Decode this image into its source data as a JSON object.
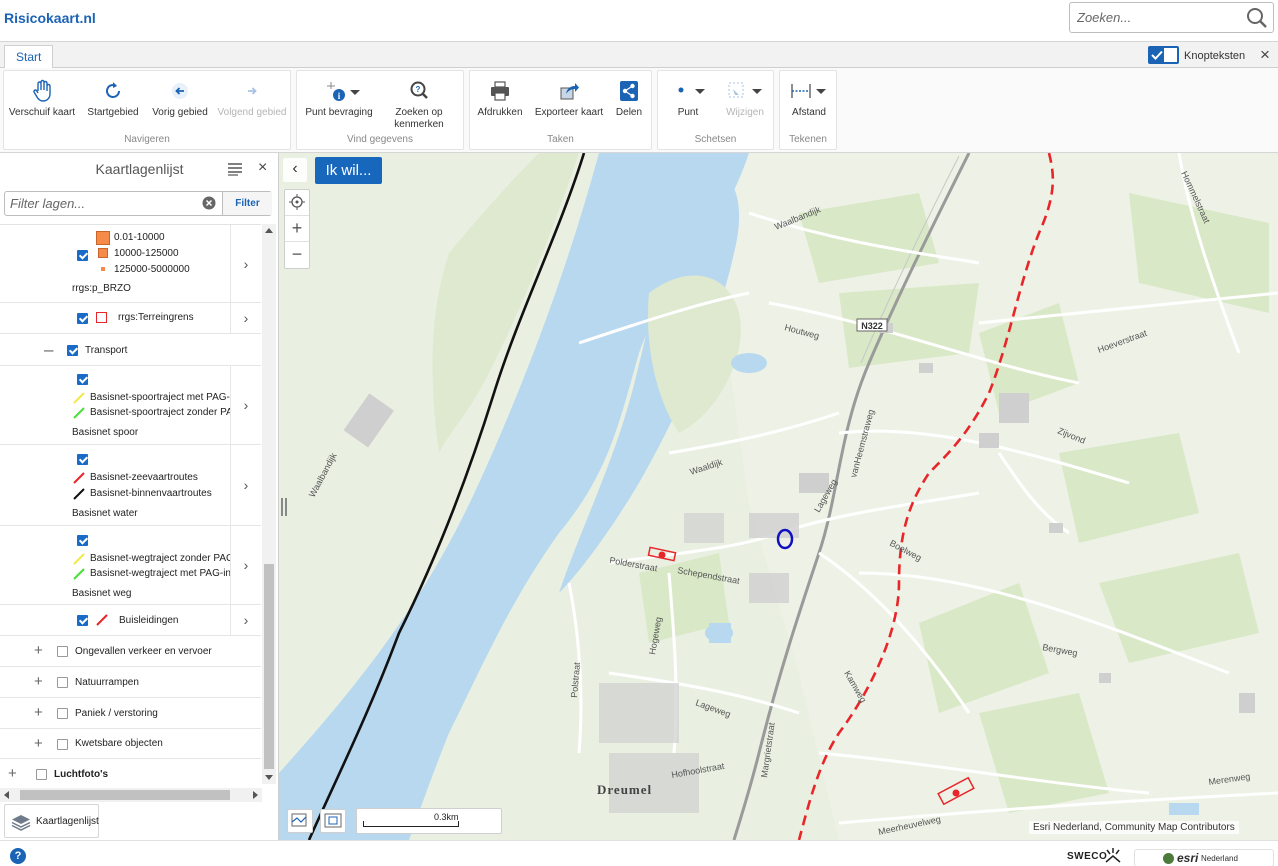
{
  "app": {
    "brand": "Risicokaart.nl"
  },
  "search": {
    "placeholder": "Zoeken..."
  },
  "tabs": [
    {
      "label": "Start"
    }
  ],
  "knopteksten": {
    "label": "Knopteksten",
    "enabled": true
  },
  "ribbon": {
    "groups": [
      {
        "label": "Navigeren",
        "buttons": [
          {
            "label": "Verschuif kaart",
            "icon": "hand-icon"
          },
          {
            "label": "Startgebied",
            "icon": "refresh-icon"
          },
          {
            "label": "Vorig gebied",
            "icon": "arrow-left-icon"
          },
          {
            "label": "Volgend gebied",
            "icon": "arrow-right-icon",
            "disabled": true
          }
        ]
      },
      {
        "label": "Vind gegevens",
        "buttons": [
          {
            "label": "Punt bevraging",
            "icon": "info-point-icon"
          },
          {
            "label": "Zoeken op kenmerken",
            "icon": "magnifier-icon"
          }
        ]
      },
      {
        "label": "Taken",
        "buttons": [
          {
            "label": "Afdrukken",
            "icon": "printer-icon"
          },
          {
            "label": "Exporteer kaart",
            "icon": "export-icon"
          },
          {
            "label": "Delen",
            "icon": "share-icon"
          }
        ]
      },
      {
        "label": "Schetsen",
        "buttons": [
          {
            "label": "Punt",
            "icon": "dot-icon"
          },
          {
            "label": "Wijzigen",
            "icon": "edit-icon",
            "disabled": true
          }
        ]
      },
      {
        "label": "Tekenen",
        "buttons": [
          {
            "label": "Afstand",
            "icon": "measure-icon"
          }
        ]
      }
    ]
  },
  "sidebar": {
    "title": "Kaartlagenlijst",
    "filter_placeholder": "Filter lagen...",
    "filter_button": "Filter",
    "legend_brzo": [
      "0.01-10000",
      "10000-125000",
      "125000-5000000"
    ],
    "layer_brzo": "rrgs:p_BRZO",
    "layer_terreingrens": "rrgs:Terreingrens",
    "group_transport": "Transport",
    "spoor_items": [
      "Basisnet-spoortraject met PAG-in",
      "Basisnet-spoortraject zonder PAG"
    ],
    "spoor_name": "Basisnet spoor",
    "water_items": [
      "Basisnet-zeevaartroutes",
      "Basisnet-binnenvaartroutes"
    ],
    "water_name": "Basisnet water",
    "weg_items": [
      "Basisnet-wegtraject zonder PAG",
      "Basisnet-wegtraject met PAG-in"
    ],
    "weg_name": "Basisnet weg",
    "layer_buisleidingen": "Buisleidingen",
    "groups": [
      "Ongevallen verkeer en vervoer",
      "Natuurrampen",
      "Paniek / verstoring",
      "Kwetsbare objecten"
    ],
    "luchtfoto": "Luchtfoto's",
    "bottom_tab": "Kaartlagenlijst"
  },
  "map": {
    "ik_wil": "Ik wil...",
    "scale_label": "0.3km",
    "attribution": "Esri Nederland, Community Map Contributors",
    "labels": {
      "waalbandijk_n": "Waalbandijk",
      "waalbandijk_w": "Waalbandijk",
      "houtweg": "Houtweg",
      "n322": "N322",
      "vanheemstraweg": "vanHeemstraweg",
      "hommelstraat": "Hommelstraat",
      "hoeverstraat": "Hoeverstraat",
      "zijvond": "Zijvond",
      "waaldijk": "Waaldijk",
      "lageweg": "Lageweg",
      "boelweg": "Boelweg",
      "polderstraat": "Polderstraat",
      "schependstraat": "Schependstraat",
      "hogeweg": "Hogeweg",
      "polstraat": "Polstraat",
      "lageweg_s": "Lageweg",
      "margrietstraat": "Margrietstraat",
      "kamweg": "Kamweg",
      "bergweg": "Bergweg",
      "merenweg": "Merenweg",
      "hofhoolstraat": "Hofhoolstraat",
      "meerheuvelweg": "Meerheuvelweg",
      "dreumel": "Dreumel"
    }
  },
  "footer": {
    "sweco": "SWECO",
    "esri": "esri",
    "esri_sub": "Nederland"
  },
  "colors": {
    "brand_blue": "#1b63b5",
    "water": "#b8d8f0",
    "red_dashed": "#e8262a",
    "orange": "#f58a49"
  }
}
